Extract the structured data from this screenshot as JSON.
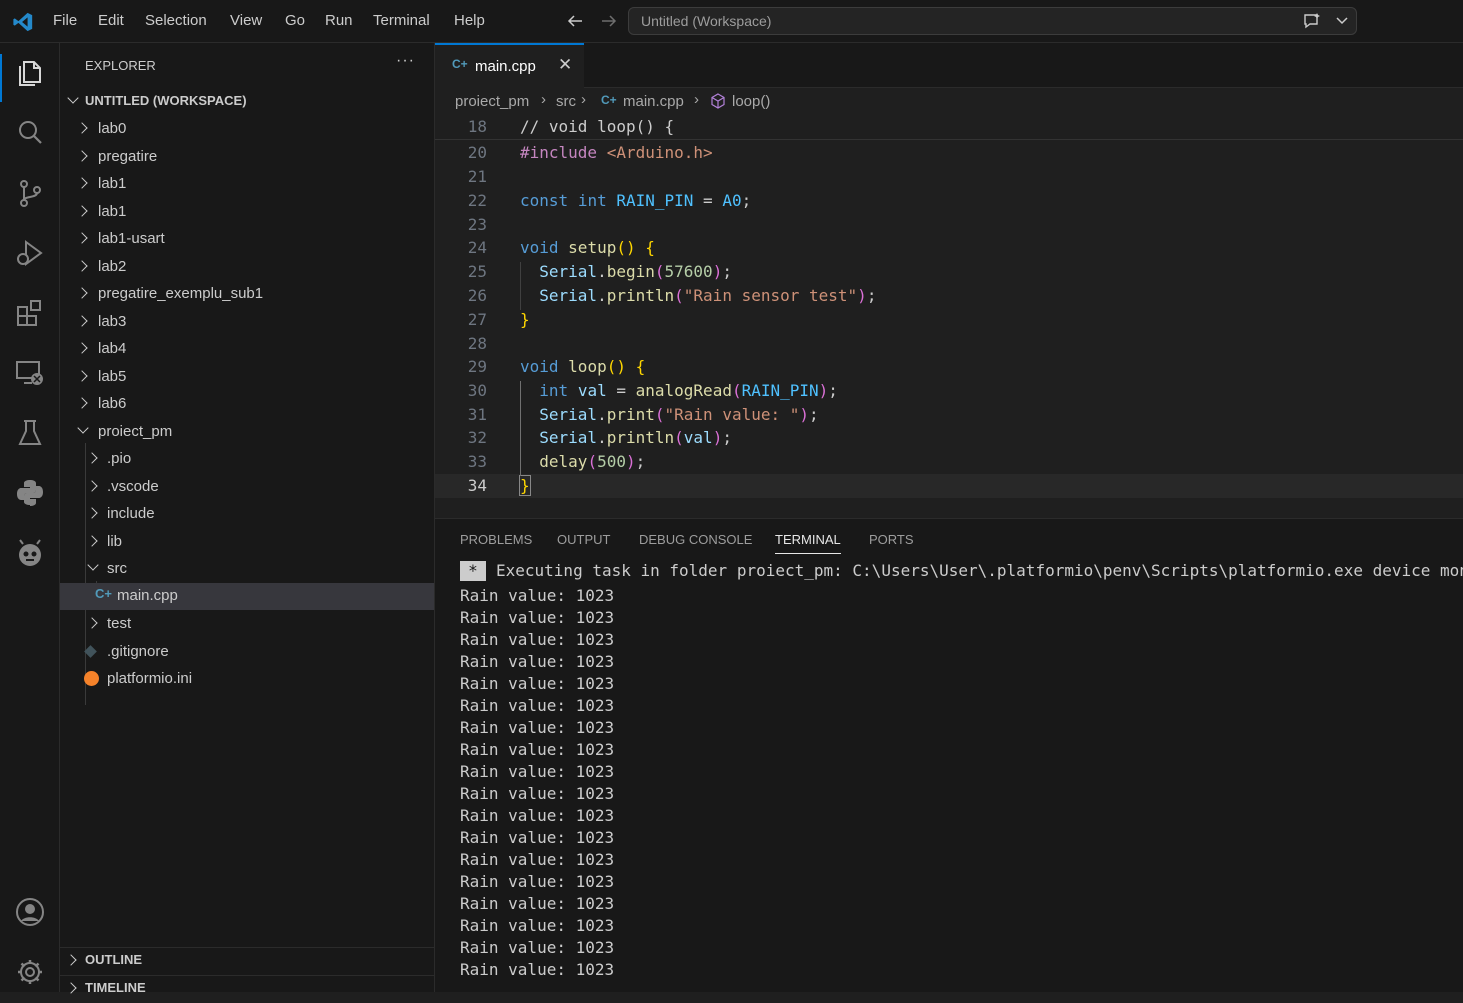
{
  "menu": [
    "File",
    "Edit",
    "Selection",
    "View",
    "Go",
    "Run",
    "Terminal",
    "Help"
  ],
  "command_center": "Untitled (Workspace)",
  "activity_icons": [
    "explorer-icon",
    "search-icon",
    "source-control-icon",
    "run-debug-icon",
    "extensions-icon",
    "remote-explorer-icon",
    "testing-icon",
    "python-icon",
    "platformio-icon",
    "account-icon",
    "settings-icon"
  ],
  "sidebar": {
    "title": "EXPLORER",
    "workspace": "UNTITLED (WORKSPACE)",
    "items": [
      {
        "label": "lab0",
        "type": "folder"
      },
      {
        "label": "pregatire",
        "type": "folder"
      },
      {
        "label": "lab1",
        "type": "folder"
      },
      {
        "label": "lab1",
        "type": "folder"
      },
      {
        "label": "lab1-usart",
        "type": "folder"
      },
      {
        "label": "lab2",
        "type": "folder"
      },
      {
        "label": "pregatire_exemplu_sub1",
        "type": "folder"
      },
      {
        "label": "lab3",
        "type": "folder"
      },
      {
        "label": "lab4",
        "type": "folder"
      },
      {
        "label": "lab5",
        "type": "folder"
      },
      {
        "label": "lab6",
        "type": "folder"
      },
      {
        "label": "proiect_pm",
        "type": "folder-open"
      },
      {
        "label": ".pio",
        "type": "folder"
      },
      {
        "label": ".vscode",
        "type": "folder"
      },
      {
        "label": "include",
        "type": "folder"
      },
      {
        "label": "lib",
        "type": "folder"
      },
      {
        "label": "src",
        "type": "folder-open"
      },
      {
        "label": "main.cpp",
        "type": "cpp"
      },
      {
        "label": "test",
        "type": "folder"
      },
      {
        "label": ".gitignore",
        "type": "git"
      },
      {
        "label": "platformio.ini",
        "type": "pio"
      }
    ],
    "outline": "OUTLINE",
    "timeline": "TIMELINE"
  },
  "tab": {
    "label": "main.cpp"
  },
  "breadcrumb": [
    "proiect_pm",
    "src",
    "main.cpp",
    "loop()"
  ],
  "code": {
    "sticky": {
      "line": "18",
      "text": "// void loop() {"
    },
    "lines": [
      "20",
      "21",
      "22",
      "23",
      "24",
      "25",
      "26",
      "27",
      "28",
      "29",
      "30",
      "31",
      "32",
      "33",
      "34"
    ]
  },
  "panel": {
    "tabs": [
      "PROBLEMS",
      "OUTPUT",
      "DEBUG CONSOLE",
      "TERMINAL",
      "PORTS"
    ],
    "active_tab": "TERMINAL",
    "task_marker": "*",
    "task_line": "Executing task in folder proiect_pm: C:\\Users\\User\\.platformio\\penv\\Scripts\\platformio.exe device monitor",
    "output": [
      "Rain value: 1023",
      "Rain value: 1023",
      "Rain value: 1023",
      "Rain value: 1023",
      "Rain value: 1023",
      "Rain value: 1023",
      "Rain value: 1023",
      "Rain value: 1023",
      "Rain value: 1023",
      "Rain value: 1023",
      "Rain value: 1023",
      "Rain value: 1023",
      "Rain value: 1023",
      "Rain value: 1023",
      "Rain value: 1023",
      "Rain value: 1023",
      "Rain value: 1023",
      "Rain value: 1023"
    ]
  },
  "colors": {
    "accent": "#0078d4",
    "editor_bg": "#1f1f1f",
    "sidebar_bg": "#181818",
    "selected": "#37373d"
  }
}
